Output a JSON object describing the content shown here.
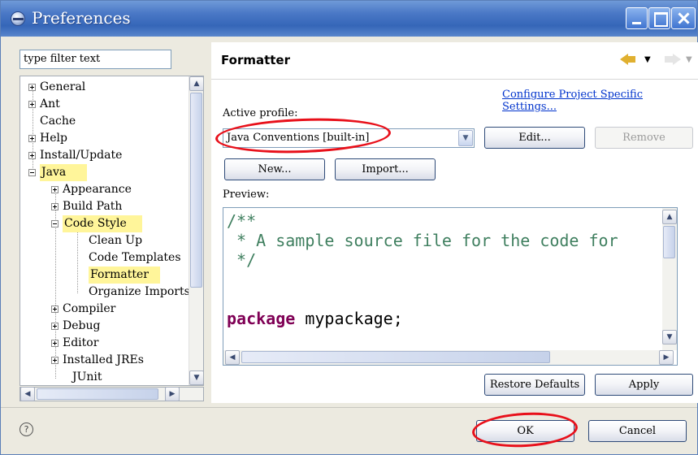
{
  "window": {
    "title": "Preferences"
  },
  "sidebar": {
    "filter_placeholder": "type filter text",
    "items": [
      {
        "label": "General"
      },
      {
        "label": "Ant"
      },
      {
        "label": "Cache"
      },
      {
        "label": "Help"
      },
      {
        "label": "Install/Update"
      },
      {
        "label": "Java"
      },
      {
        "label": "Appearance"
      },
      {
        "label": "Build Path"
      },
      {
        "label": "Code Style"
      },
      {
        "label": "Clean Up"
      },
      {
        "label": "Code Templates"
      },
      {
        "label": "Formatter"
      },
      {
        "label": "Organize Imports"
      },
      {
        "label": "Compiler"
      },
      {
        "label": "Debug"
      },
      {
        "label": "Editor"
      },
      {
        "label": "Installed JREs"
      },
      {
        "label": "JUnit"
      }
    ]
  },
  "page": {
    "title": "Formatter",
    "configure_link": "Configure Project Specific Settings...",
    "active_profile_label": "Active profile:",
    "active_profile_value": "Java Conventions [built-in]",
    "edit_label": "Edit...",
    "remove_label": "Remove",
    "new_label": "New...",
    "import_label": "Import...",
    "preview_label": "Preview:",
    "preview_code": {
      "line1": "/**",
      "line2": " * A sample source file for the code for",
      "line3": " */",
      "kw": "package",
      "pkg": " mypackage;"
    },
    "restore_defaults_label": "Restore Defaults",
    "apply_label": "Apply"
  },
  "footer": {
    "help_symbol": "?",
    "ok_label": "OK",
    "cancel_label": "Cancel"
  },
  "colors": {
    "highlight": "#fff59a",
    "annotation_ring": "#e8101a",
    "link": "#0033cc",
    "titlebar": "#3566b8"
  }
}
